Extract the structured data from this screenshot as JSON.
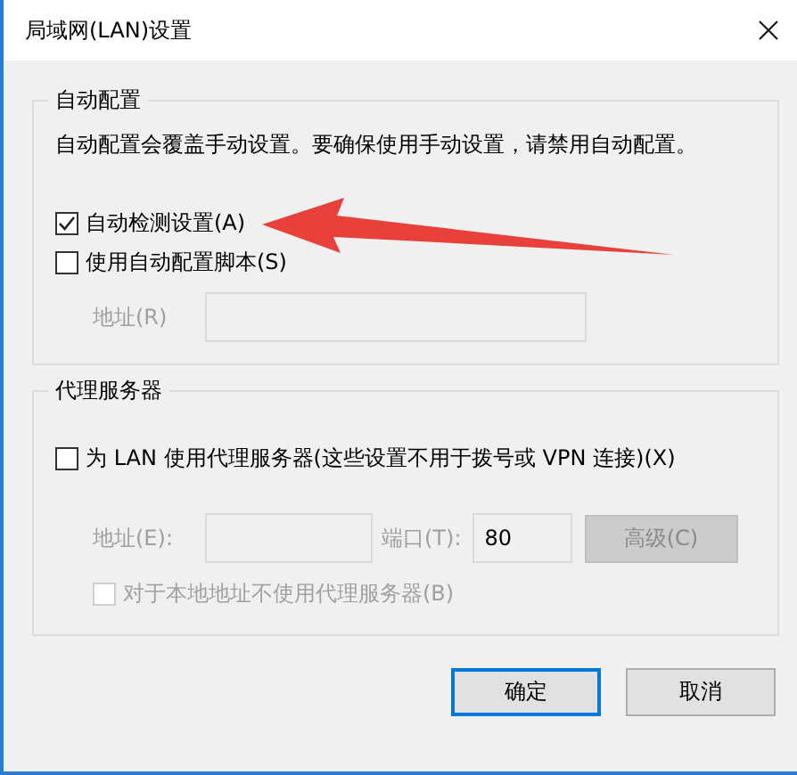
{
  "window": {
    "title": "局域网(LAN)设置"
  },
  "auto_config": {
    "title": "自动配置",
    "description": "自动配置会覆盖手动设置。要确保使用手动设置，请禁用自动配置。",
    "options": [
      {
        "label": "自动检测设置(A)",
        "checked": true
      },
      {
        "label": "使用自动配置脚本(S)",
        "checked": false
      }
    ],
    "address": {
      "label": "地址(R)",
      "disabled": true
    }
  },
  "proxy": {
    "title": "代理服务器",
    "option": {
      "label": "为 LAN 使用代理服务器(这些设置不用于拨号或 VPN 连接)(X)",
      "checked": false
    },
    "address": {
      "label": "地址(E):",
      "disabled": true
    },
    "port": {
      "label": "端口(T):",
      "value": "80",
      "disabled": true
    },
    "advanced_button": {
      "label": "高级(C)",
      "disabled": true
    },
    "bypass": {
      "label": "对于本地地址不使用代理服务器(B)",
      "checked": false,
      "disabled": true
    }
  },
  "buttons": [
    {
      "label": "确定",
      "default": true
    },
    {
      "label": "取消",
      "default": false
    }
  ],
  "annotation": {
    "kind": "arrow"
  }
}
